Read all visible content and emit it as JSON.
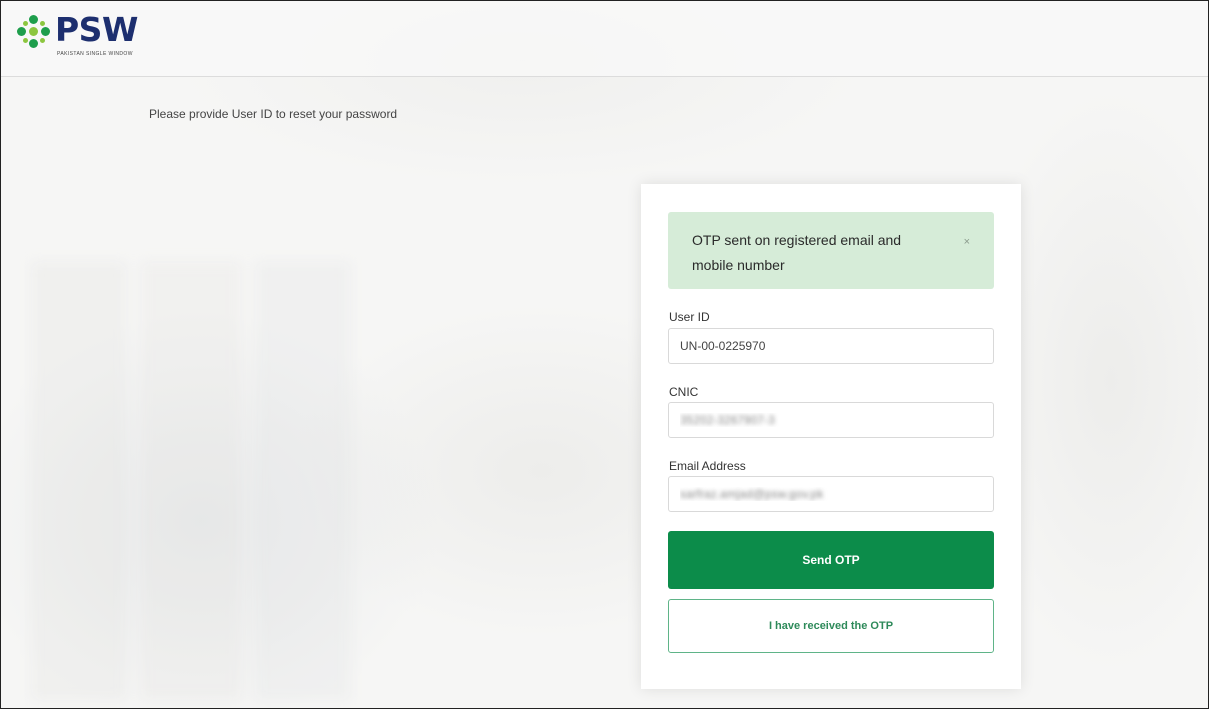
{
  "brand": {
    "name": "PSW",
    "tagline": "PAKISTAN SINGLE WINDOW",
    "color": "#1d2f6f",
    "mark_colors": [
      "#1e9e4c",
      "#8cc63f",
      "#1d2f6f"
    ]
  },
  "page": {
    "instruction": "Please provide User ID to reset your password"
  },
  "alert": {
    "message": "OTP sent on registered email and mobile number",
    "close": "×",
    "background": "#d6ecd8"
  },
  "form": {
    "user_id": {
      "label": "User ID",
      "value": "UN-00-0225970"
    },
    "cnic": {
      "label": "CNIC",
      "value": "35202-3267907-3"
    },
    "email": {
      "label": "Email Address",
      "value": "sarfraz.amjad@psw.gov.pk"
    }
  },
  "buttons": {
    "send_otp": "Send OTP",
    "received_otp": "I have received the OTP",
    "primary_color": "#0c8c4a"
  },
  "icons": {
    "logo_mark": "psw-dots-icon",
    "close": "close-icon"
  }
}
